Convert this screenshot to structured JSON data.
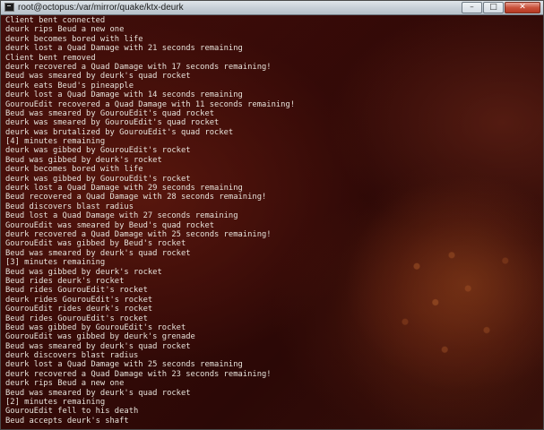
{
  "window": {
    "title": "root@octopus:/var/mirror/quake/ktx-deurk",
    "icon": "terminal-icon",
    "controls": {
      "minimize": "–",
      "maximize": "□",
      "close": "✕"
    }
  },
  "terminal": {
    "lines": [
      "Client bent connected",
      "deurk rips Beud a new one",
      "deurk becomes bored with life",
      "deurk lost a Quad Damage with 21 seconds remaining",
      "Client bent removed",
      "deurk recovered a Quad Damage with 17 seconds remaining!",
      "Beud was smeared by deurk's quad rocket",
      "deurk eats Beud's pineapple",
      "deurk lost a Quad Damage with 14 seconds remaining",
      "GourouEdit recovered a Quad Damage with 11 seconds remaining!",
      "Beud was smeared by GourouEdit's quad rocket",
      "deurk was smeared by GourouEdit's quad rocket",
      "deurk was brutalized by GourouEdit's quad rocket",
      "[4] minutes remaining",
      "deurk was gibbed by GourouEdit's rocket",
      "Beud was gibbed by deurk's rocket",
      "deurk becomes bored with life",
      "deurk was gibbed by GourouEdit's rocket",
      "deurk lost a Quad Damage with 29 seconds remaining",
      "Beud recovered a Quad Damage with 28 seconds remaining!",
      "Beud discovers blast radius",
      "Beud lost a Quad Damage with 27 seconds remaining",
      "GourouEdit was smeared by Beud's quad rocket",
      "deurk recovered a Quad Damage with 25 seconds remaining!",
      "GourouEdit was gibbed by Beud's rocket",
      "Beud was smeared by deurk's quad rocket",
      "[3] minutes remaining",
      "Beud was gibbed by deurk's rocket",
      "Beud rides deurk's rocket",
      "Beud rides GourouEdit's rocket",
      "deurk rides GourouEdit's rocket",
      "GourouEdit rides deurk's rocket",
      "Beud rides GourouEdit's rocket",
      "Beud was gibbed by GourouEdit's rocket",
      "GourouEdit was gibbed by deurk's grenade",
      "Beud was smeared by deurk's quad rocket",
      "deurk discovers blast radius",
      "deurk lost a Quad Damage with 25 seconds remaining",
      "deurk recovered a Quad Damage with 23 seconds remaining!",
      "deurk rips Beud a new one",
      "Beud was smeared by deurk's quad rocket",
      "[2] minutes remaining",
      "GourouEdit fell to his death",
      "Beud accepts deurk's shaft"
    ]
  },
  "colors": {
    "terminal_text": "#e7e2da",
    "background": "#3a0b08",
    "titlebar": "#c6cfd6"
  }
}
